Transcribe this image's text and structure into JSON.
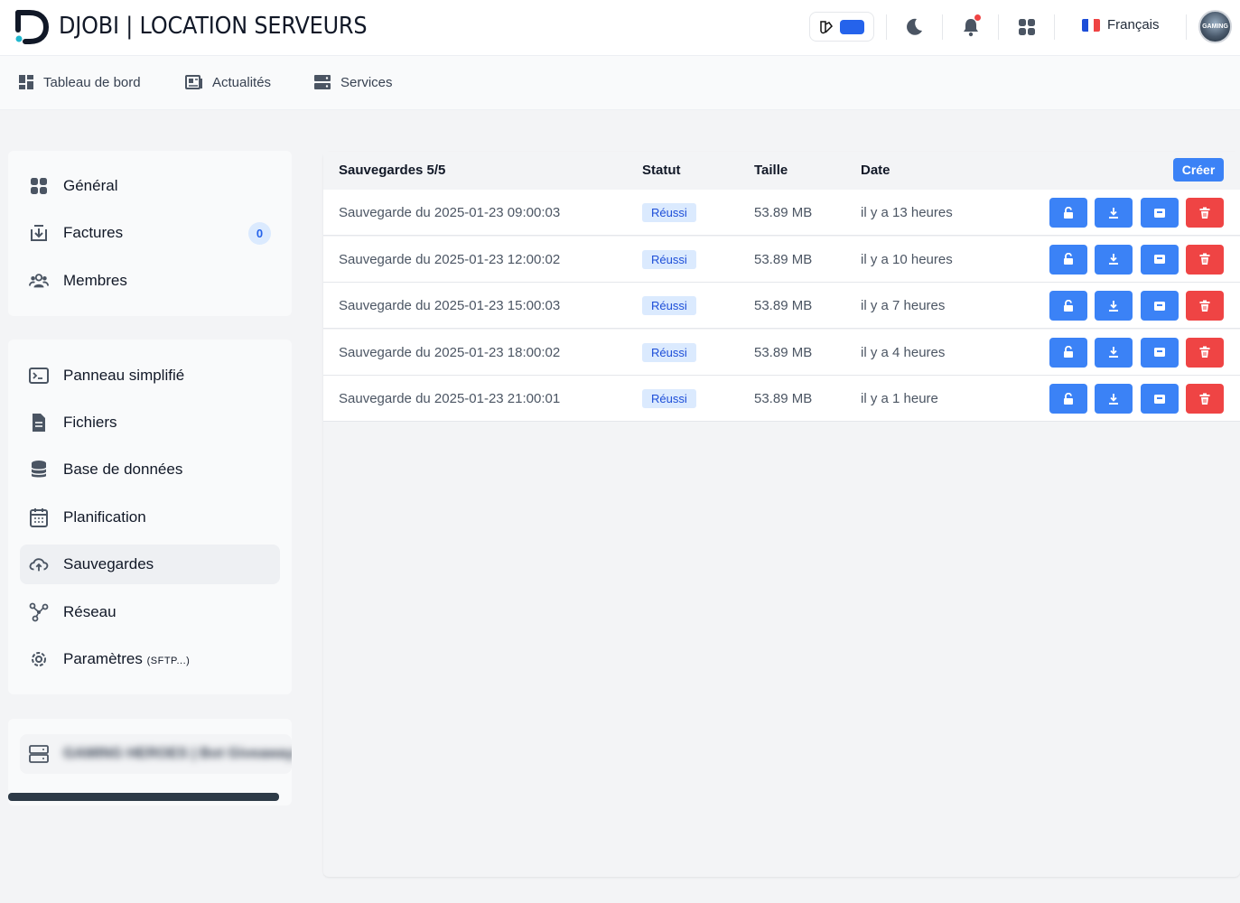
{
  "app": {
    "title": "DJOBI | LOCATION SERVEURS"
  },
  "header": {
    "language": "Français",
    "avatar_text": "GAMING"
  },
  "nav": [
    {
      "label": "Tableau de bord",
      "icon": "dashboard-icon"
    },
    {
      "label": "Actualités",
      "icon": "news-icon"
    },
    {
      "label": "Services",
      "icon": "server-icon"
    }
  ],
  "sidebar": {
    "account": [
      {
        "label": "Général",
        "icon": "grid-icon"
      },
      {
        "label": "Factures",
        "icon": "invoice-icon",
        "count": "0"
      },
      {
        "label": "Membres",
        "icon": "users-icon"
      }
    ],
    "server": [
      {
        "label": "Panneau simplifié",
        "icon": "terminal-icon"
      },
      {
        "label": "Fichiers",
        "icon": "file-icon"
      },
      {
        "label": "Base de données",
        "icon": "database-icon"
      },
      {
        "label": "Planification",
        "icon": "calendar-icon"
      },
      {
        "label": "Sauvegardes",
        "icon": "cloud-upload-icon",
        "active": true
      },
      {
        "label": "Réseau",
        "icon": "network-icon"
      },
      {
        "label": "Paramètres",
        "suffix": "(SFTP...)",
        "icon": "settings-icon"
      }
    ],
    "server_name": "GAMING HEROES | Bot Giveaways"
  },
  "backups": {
    "header": {
      "title": "Sauvegardes 5/5",
      "status": "Statut",
      "size": "Taille",
      "date": "Date",
      "create_label": "Créer"
    },
    "rows": [
      {
        "name": "Sauvegarde du 2025-01-23 09:00:03",
        "status": "Réussi",
        "size": "53.89 MB",
        "date": "il y a 13 heures"
      },
      {
        "name": "Sauvegarde du 2025-01-23 12:00:02",
        "status": "Réussi",
        "size": "53.89 MB",
        "date": "il y a 10 heures"
      },
      {
        "name": "Sauvegarde du 2025-01-23 15:00:03",
        "status": "Réussi",
        "size": "53.89 MB",
        "date": "il y a 7 heures"
      },
      {
        "name": "Sauvegarde du 2025-01-23 18:00:02",
        "status": "Réussi",
        "size": "53.89 MB",
        "date": "il y a 4 heures"
      },
      {
        "name": "Sauvegarde du 2025-01-23 21:00:01",
        "status": "Réussi",
        "size": "53.89 MB",
        "date": "il y a 1 heure"
      }
    ]
  },
  "colors": {
    "accent": "#3b82f6",
    "danger": "#ef4444",
    "badge_bg": "#dbeafe"
  }
}
